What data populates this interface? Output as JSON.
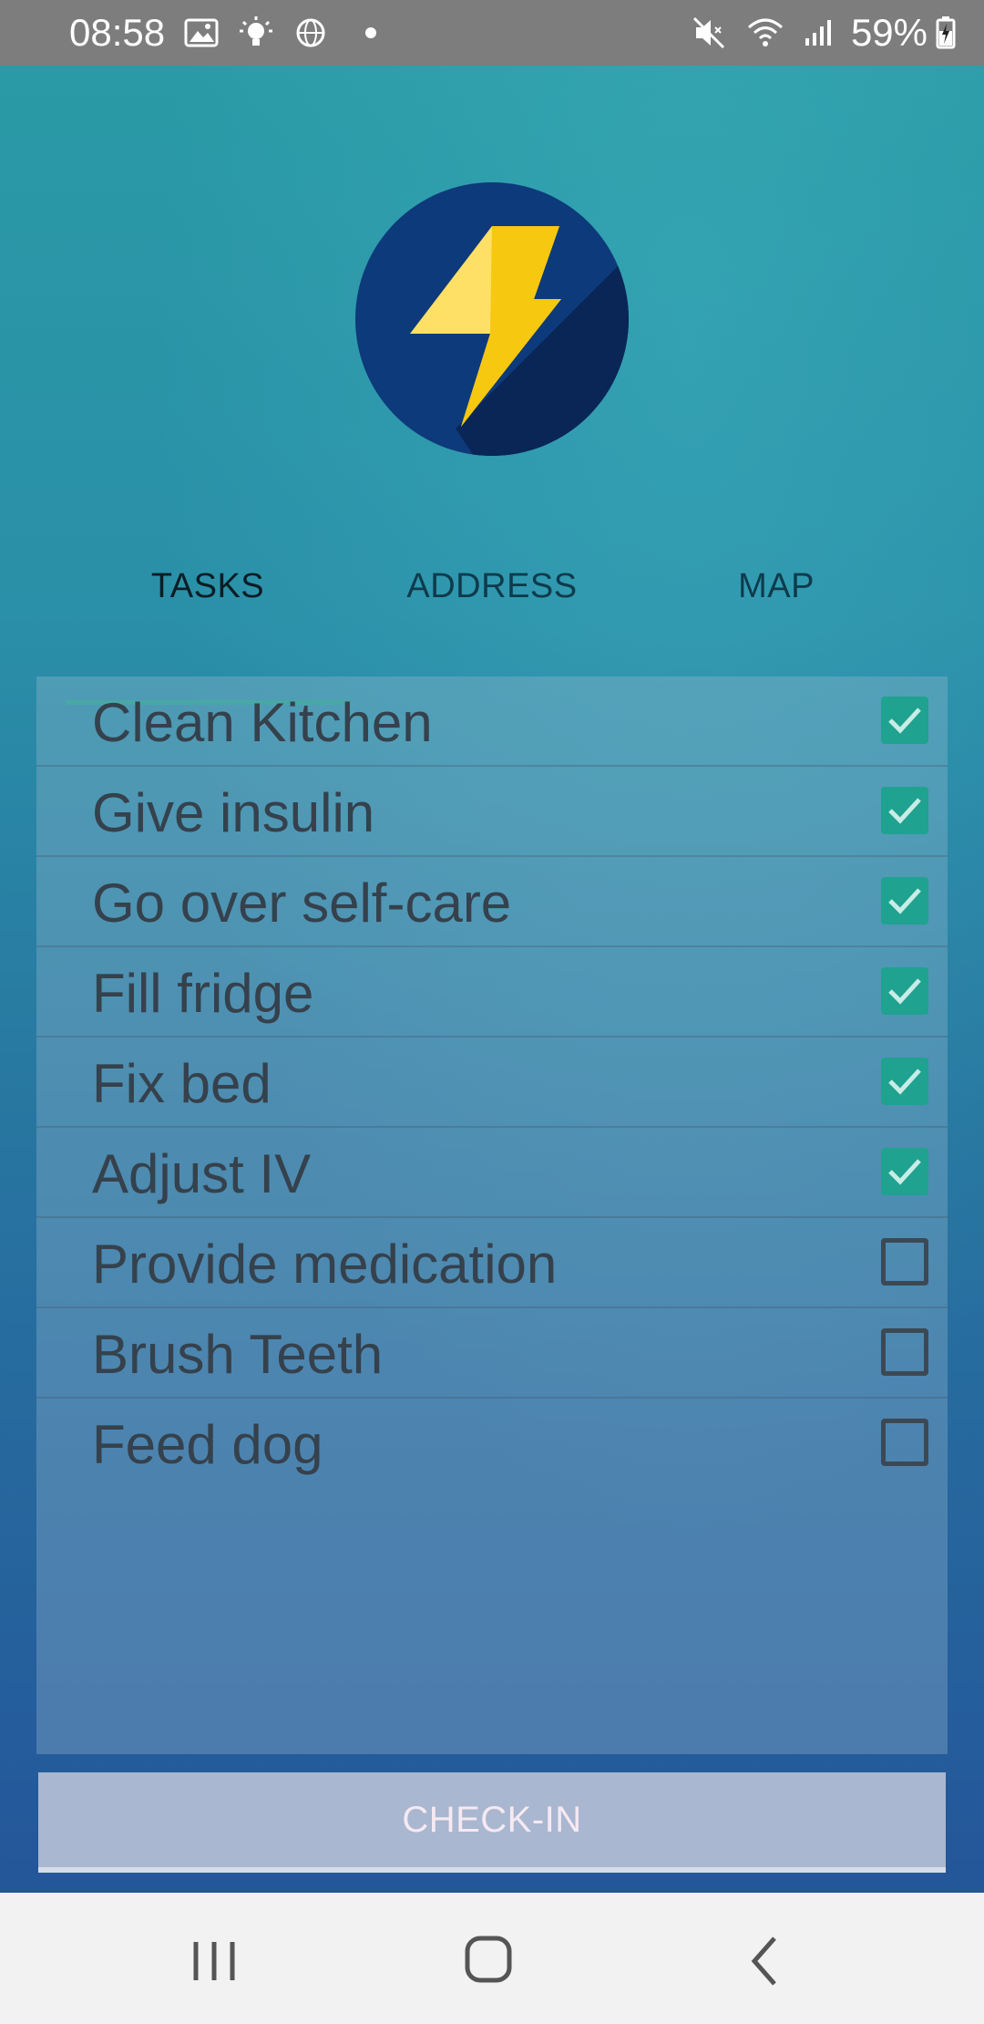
{
  "status_bar": {
    "time": "08:58",
    "battery": "59%",
    "icons_left": [
      "image-icon",
      "bulb-icon",
      "globe-icon",
      "dot"
    ],
    "icons_right": [
      "mute-icon",
      "wifi-icon",
      "signal-icon",
      "battery-icon"
    ]
  },
  "app": {
    "logo_icon": "lightning-bolt-icon",
    "colors": {
      "accent": "#1fa28f",
      "logo_circle": "#0d3a7a",
      "bolt": "#f6c80f"
    }
  },
  "tabs": [
    {
      "label": "TASKS",
      "active": true
    },
    {
      "label": "ADDRESS",
      "active": false
    },
    {
      "label": "MAP",
      "active": false
    }
  ],
  "tasks": [
    {
      "label": "Clean Kitchen",
      "checked": true
    },
    {
      "label": "Give insulin",
      "checked": true
    },
    {
      "label": "Go over self-care",
      "checked": true
    },
    {
      "label": "Fill fridge",
      "checked": true
    },
    {
      "label": "Fix bed",
      "checked": true
    },
    {
      "label": "Adjust IV",
      "checked": true
    },
    {
      "label": "Provide medication",
      "checked": false
    },
    {
      "label": "Brush Teeth",
      "checked": false
    },
    {
      "label": "Feed dog",
      "checked": false
    }
  ],
  "checkin": {
    "label": "CHECK-IN"
  },
  "nav_bar": {
    "buttons": [
      "recent-apps-icon",
      "home-icon",
      "back-icon"
    ]
  }
}
